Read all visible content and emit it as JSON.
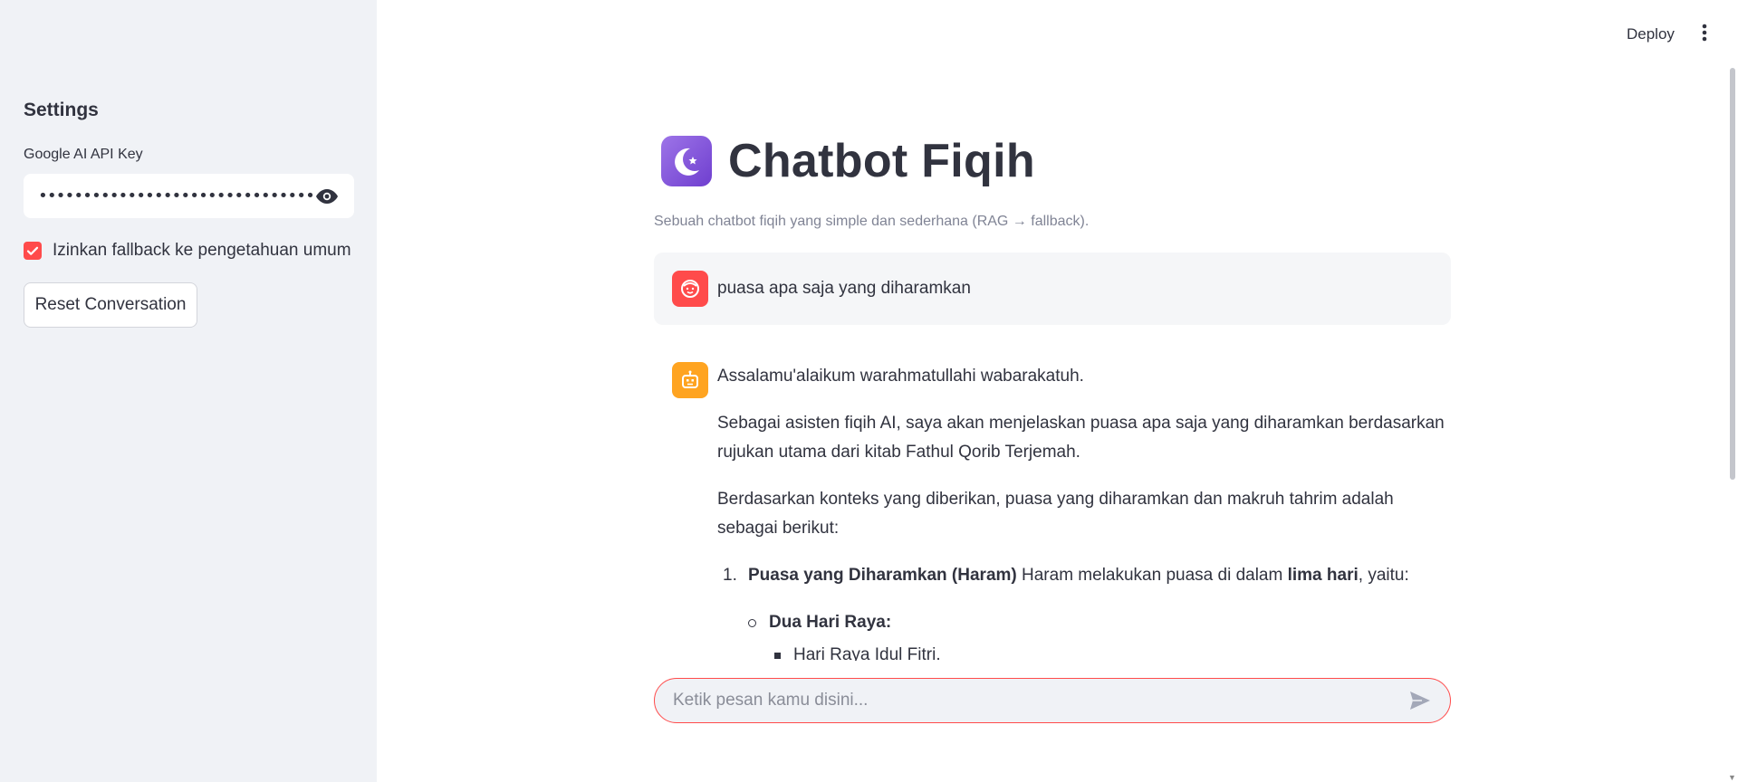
{
  "sidebar": {
    "heading": "Settings",
    "api_key_label": "Google AI API Key",
    "api_key_value": "•••••••••••••••••••••••••••••••••••••••",
    "fallback_label": "Izinkan fallback ke pengetahuan umum",
    "fallback_checked": true,
    "reset_label": "Reset Conversation"
  },
  "topbar": {
    "deploy_label": "Deploy"
  },
  "main": {
    "title": "Chatbot Fiqih",
    "subtitle": "Sebuah chatbot fiqih yang simple dan sederhana (RAG → fallback).",
    "user_message": "puasa apa saja yang diharamkan",
    "bot": {
      "greeting": "Assalamu'alaikum warahmatullahi wabarakatuh.",
      "para1": "Sebagai asisten fiqih AI, saya akan menjelaskan puasa apa saja yang diharamkan berdasarkan rujukan utama dari kitab Fathul Qorib Terjemah.",
      "para2": "Berdasarkan konteks yang diberikan, puasa yang diharamkan dan makruh tahrim adalah sebagai berikut:",
      "list_num": "1.",
      "list_bold": "Puasa yang Diharamkan (Haram)",
      "list_text_a": " Haram melakukan puasa di dalam ",
      "list_bold_2": "lima hari",
      "list_text_b": ", yaitu:",
      "sub_bold": "Dua Hari Raya:",
      "sub_item": "Hari Raya Idul Fitri."
    },
    "input_placeholder": "Ketik pesan kamu disini..."
  },
  "colors": {
    "accent": "#ff4b4b",
    "sidebar_bg": "#f0f2f6",
    "bot_avatar": "#ffa421",
    "text": "#31333f"
  }
}
